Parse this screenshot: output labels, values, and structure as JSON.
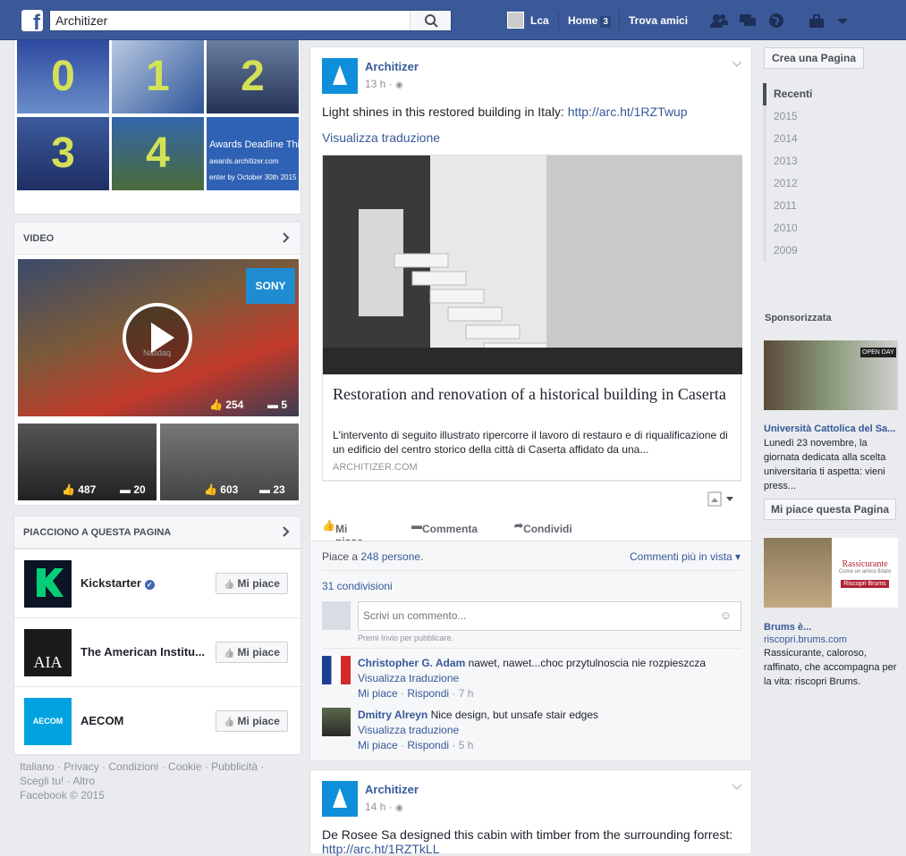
{
  "topbar": {
    "search_value": "Architizer",
    "user_name": "Lca",
    "home_label": "Home",
    "home_count": "3",
    "find_friends": "Trova amici"
  },
  "left": {
    "photo_tiles": [
      "0",
      "1",
      "2",
      "3",
      "4",
      "Awards Deadline This"
    ],
    "award_sub1": "awards.architizer.com",
    "award_sub2": "enter by October 30th 2015",
    "video_heading": "VIDEO",
    "video_main_likes": "254",
    "video_main_comments": "5",
    "video_main_sign1": "SONY",
    "video_main_sign2": "Nasdaq",
    "video_small1_likes": "487",
    "video_small1_comments": "20",
    "video_small2_likes": "603",
    "video_small2_comments": "23",
    "likes_heading": "PIACCIONO A QUESTA PAGINA",
    "pages": [
      {
        "name": "Kickstarter",
        "button": "Mi piace",
        "thumb_color": "#05ce78",
        "thumb_letter": "K"
      },
      {
        "name": "The American Institu...",
        "button": "Mi piace",
        "thumb_color": "#1a1a1a",
        "thumb_letter": "AIA"
      },
      {
        "name": "AECOM",
        "button": "Mi piace",
        "thumb_color": "#00a3e0",
        "thumb_letter": "AECOM"
      }
    ],
    "footer": {
      "line1": "Italiano · Privacy · Condizioni · Cookie · Pubblicità ·",
      "line2": "Scegli tu! · Altro",
      "line3": "Facebook © 2015"
    }
  },
  "post1": {
    "author": "Architizer",
    "time": "13 h ·",
    "text": "Light shines in this restored building in Italy: ",
    "link": "http://arc.ht/1RZTwup",
    "translate": "Visualizza traduzione",
    "card_title": "Restoration and renovation of a historical building in Caserta",
    "card_desc": "L'intervento di seguito illustrato ripercorre il lavoro di restauro e di riqualificazione di un edificio del centro storico della città di Caserta affidato da una...",
    "card_domain": "ARCHITIZER.COM",
    "actions": {
      "like": "Mi piace",
      "comment": "Commenta",
      "share": "Condividi"
    },
    "likes_prefix": "Piace a ",
    "likes_link": "248 persone",
    "likes_suffix": ".",
    "sort": "Commenti più in vista",
    "shares": "31 condivisioni",
    "comment_placeholder": "Scrivi un commento...",
    "enter_hint": "Premi Invio per pubblicare.",
    "comments": [
      {
        "author": "Christopher G. Adam",
        "text": " nawet, nawet...choc przytulnoscia nie rozpieszcza",
        "translate": "Visualizza traduzione",
        "like": "Mi piace",
        "reply": "Rispondi",
        "time": "7 h"
      },
      {
        "author": "Dmitry Alreyn",
        "text": " Nice design, but unsafe stair edges",
        "translate": "Visualizza traduzione",
        "like": "Mi piace",
        "reply": "Rispondi",
        "time": "5 h"
      }
    ]
  },
  "post2": {
    "author": "Architizer",
    "time": "14 h ·",
    "text": "De Rosee Sa designed this cabin with timber from the surrounding forrest:",
    "link": "http://arc.ht/1RZTkLL"
  },
  "right": {
    "create_page": "Crea una Pagina",
    "years": [
      "Recenti",
      "2015",
      "2014",
      "2013",
      "2012",
      "2011",
      "2010",
      "2009"
    ],
    "sponsored": "Sponsorizzata",
    "ad1": {
      "title": "Università Cattolica del Sa...",
      "text": "Lunedì 23 novembre, la giornata dedicata alla scelta universitaria ti aspetta: vieni press...",
      "button": "Mi piace questa Pagina",
      "sign": "OPEN DAY"
    },
    "ad2": {
      "title": "Brums è...",
      "domain": "riscopri.brums.com",
      "text": "Rassicurante, caloroso, raffinato, che accompagna per la vita: riscopri Brums.",
      "img_title": "Rassicurante",
      "img_sub": "Come un amico fidato",
      "img_btn": "Riscopri Brums"
    }
  }
}
